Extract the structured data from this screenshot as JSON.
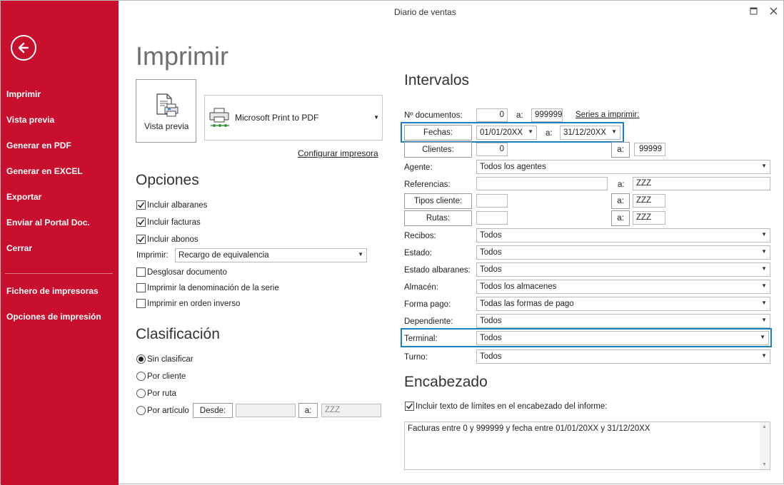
{
  "window": {
    "title": "Diario de ventas",
    "maximize_icon": "maximize-icon",
    "close_icon": "close-icon"
  },
  "colors": {
    "sidebar": "#c8102e",
    "highlight": "#1a80c4"
  },
  "sidebar": {
    "back_icon": "arrow-left-icon",
    "items": [
      {
        "label": "Imprimir"
      },
      {
        "label": "Vista previa"
      },
      {
        "label": "Generar en PDF"
      },
      {
        "label": "Generar en EXCEL"
      },
      {
        "label": "Exportar"
      },
      {
        "label": "Enviar al Portal Doc."
      },
      {
        "label": "Cerrar"
      },
      {
        "label": "Fichero de impresoras"
      },
      {
        "label": "Opciones de impresión"
      }
    ]
  },
  "main": {
    "title": "Imprimir",
    "preview_button": "Vista previa",
    "printer": {
      "name": "Microsoft Print to PDF"
    },
    "configure_link": "Configurar impresora"
  },
  "opciones": {
    "title": "Opciones",
    "incluir_albaranes": "Incluir albaranes",
    "incluir_facturas": "Incluir facturas",
    "incluir_abonos": "Incluir abonos",
    "imprimir_label": "Imprimir:",
    "imprimir_value": "Recargo de equivalencia",
    "desglosar": "Desglosar documento",
    "denominacion": "Imprimir la denominación de la serie",
    "orden_inverso": "Imprimir en orden inverso"
  },
  "clasificacion": {
    "title": "Clasificación",
    "sin_clasificar": "Sin clasificar",
    "por_cliente": "Por cliente",
    "por_ruta": "Por ruta",
    "por_articulo": "Por artículo",
    "desde_button": "Desde:",
    "desde_value": "",
    "a_button": "a:",
    "a_value": "ZZZ"
  },
  "intervalos": {
    "title": "Intervalos",
    "documentos_label": "Nº documentos:",
    "documentos_from": "0",
    "documentos_a": "a:",
    "documentos_to": "999999",
    "series_link": "Series a imprimir:",
    "fechas_button": "Fechas:",
    "fecha_from": "01/01/20XX",
    "fechas_a": "a:",
    "fecha_to": "31/12/20XX",
    "clientes_button": "Clientes:",
    "clientes_from": "0",
    "clientes_a_button": "a:",
    "clientes_to": "99999",
    "agente_label": "Agente:",
    "agente_value": "Todos los agentes",
    "referencias_label": "Referencias:",
    "referencias_from": "",
    "referencias_a": "a:",
    "referencias_to": "ZZZ",
    "tipos_button": "Tipos cliente:",
    "tipos_from": "",
    "tipos_a_button": "a:",
    "tipos_to": "ZZZ",
    "rutas_button": "Rutas:",
    "rutas_from": "",
    "rutas_a_button": "a:",
    "rutas_to": "ZZZ",
    "recibos_label": "Recibos:",
    "recibos_value": "Todos",
    "estado_label": "Estado:",
    "estado_value": "Todos",
    "estado_alb_label": "Estado albaranes:",
    "estado_alb_value": "Todos",
    "almacen_label": "Almacén:",
    "almacen_value": "Todos los almacenes",
    "forma_pago_label": "Forma pago:",
    "forma_pago_value": "Todas las formas de pago",
    "dependiente_label": "Dependiente:",
    "dependiente_value": "Todos",
    "terminal_label": "Terminal:",
    "terminal_value": "Todos",
    "turno_label": "Turno:",
    "turno_value": "Todos"
  },
  "encabezado": {
    "title": "Encabezado",
    "checkbox_label": "Incluir texto de límites en el encabezado del informe:",
    "text": "Facturas entre 0 y 999999 y fecha entre 01/01/20XX y 31/12/20XX"
  }
}
